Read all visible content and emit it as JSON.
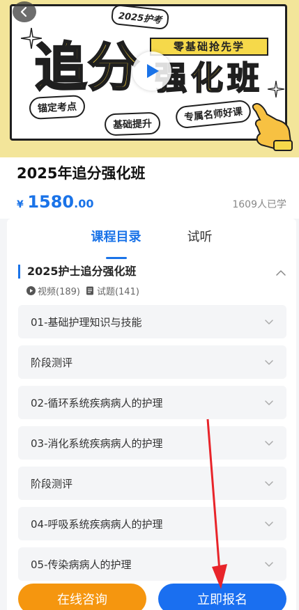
{
  "banner": {
    "tag_year": "2025护考",
    "tag_zero": "零基础抢先学",
    "big_title": "追分",
    "big_sub": "强化班",
    "pill_1": "锚定考点",
    "pill_2": "基础提升",
    "pill_3": "专属名师好课"
  },
  "course": {
    "title": "2025年追分强化班",
    "price_symbol": "¥",
    "price_int": "1580",
    "price_dec": ".00",
    "learners": "1609人已学"
  },
  "tabs": [
    {
      "label": "课程目录"
    },
    {
      "label": "试听"
    }
  ],
  "chapter": {
    "title": "2025护士追分强化班",
    "videos": "视频(189)",
    "quizzes": "试题(141)"
  },
  "lessons": [
    {
      "label": "01-基础护理知识与技能"
    },
    {
      "label": "阶段测评"
    },
    {
      "label": "02-循环系统疾病病人的护理"
    },
    {
      "label": "03-消化系统疾病病人的护理"
    },
    {
      "label": "阶段测评"
    },
    {
      "label": "04-呼吸系统疾病病人的护理"
    },
    {
      "label": "05-传染病病人的护理"
    }
  ],
  "actions": {
    "consult": "在线咨询",
    "enroll": "立即报名"
  },
  "colors": {
    "accent": "#1a73e8",
    "orange": "#f5960f",
    "annotation": "#e8242a"
  }
}
